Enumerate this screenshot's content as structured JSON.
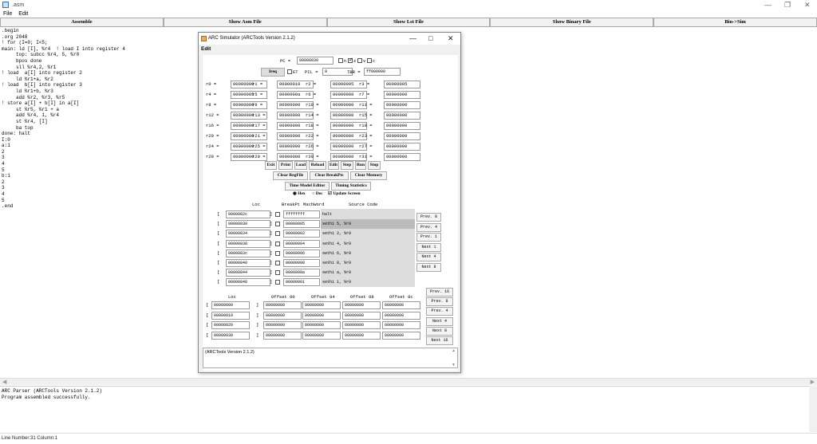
{
  "window": {
    "title": ".asm"
  },
  "menu": [
    "File",
    "Edit"
  ],
  "top_buttons": [
    "Assemble",
    "Show Asm File",
    "Show Lst File",
    "Show Binary File",
    "Bin->Sim"
  ],
  "editor_lines": [
    ".begin",
    ".org 2048",
    "! for (I=0; I<5;",
    "main: ld [I], %r4  ! load I into register 4",
    "     top: subcc %r4, 5, %r0",
    "     bpos done",
    "     sll %r4,2, %r1",
    "! load  a[I] into register 2",
    "     ld %r1+a, %r2",
    "! load  b[I] into register 3",
    "     ld %r1+b, %r3",
    "     add %r2, %r3, %r5",
    "! store a[I] + b[I] in a[I]",
    "     st %r5, %r1 + a",
    "     add %r4, 1, %r4",
    "     st %r4, [I]",
    "     ba top",
    "done: halt",
    "I:0",
    "a:1",
    "2",
    "3",
    "4",
    "5",
    "b:1",
    "2",
    "3",
    "4",
    "5",
    ".end"
  ],
  "console_lines": [
    "ARC Parser (ARCTools Version 2.1.2)",
    "Program assembled successfully."
  ],
  "status": "Line Number:31 Column:1",
  "sim": {
    "title": "ARC Simulator (ARCTools Version 2.1.2)",
    "menu": "Edit",
    "pc_label": "PC =",
    "pc": "00000830",
    "flags": [
      "n",
      "z",
      "v",
      "c"
    ],
    "ireq_label": "Ireq",
    "et_label": "ET",
    "pil_label": "PIL =",
    "pil": "0",
    "tbr_label": "TBR =",
    "tbr": "ff000000",
    "registers": [
      [
        "r0 =",
        "00000000",
        "r1 =",
        "00000010",
        "r2 =",
        "00000005",
        "r3 =",
        "00000005"
      ],
      [
        "r4 =",
        "00000005",
        "r5 =",
        "0000000a",
        "r6 =",
        "00000000",
        "r7 =",
        "00000000"
      ],
      [
        "r8 =",
        "00000000",
        "r9 =",
        "00000000",
        "r10 =",
        "00000000",
        "r11 =",
        "00000000"
      ],
      [
        "r12 =",
        "00000000",
        "r13 =",
        "00000000",
        "r14 =",
        "00000000",
        "r15 =",
        "00000000"
      ],
      [
        "r16 =",
        "00000000",
        "r17 =",
        "00000000",
        "r18 =",
        "00000000",
        "r19 =",
        "00000000"
      ],
      [
        "r20 =",
        "00000000",
        "r21 =",
        "00000000",
        "r22 =",
        "00000000",
        "r23 =",
        "00000000"
      ],
      [
        "r24 =",
        "00000000",
        "r25 =",
        "00000000",
        "r26 =",
        "00000000",
        "r27 =",
        "00000000"
      ],
      [
        "r28 =",
        "00000000",
        "r29 =",
        "00000000",
        "r30 =",
        "00000000",
        "r31 =",
        "00000000"
      ]
    ],
    "buttons_row1": [
      "Exit",
      "Print",
      "Load",
      "Reload",
      "Edit",
      "Step",
      "Run",
      "Stop"
    ],
    "buttons_row2": [
      "Clear RegFile",
      "Clear BreakPts",
      "Clear Memory"
    ],
    "buttons_row3": [
      "Time Model Editor",
      "Timing Statistics"
    ],
    "radio_hex": "Hex",
    "radio_dec": "Dec",
    "update_screen": "Update Screen",
    "code_headers": [
      "Loc",
      "BreakPt",
      "MachWord",
      "Source Code"
    ],
    "code_rows": [
      [
        "0000082c",
        "ffffffff",
        "halt"
      ],
      [
        "00000830",
        "00000005",
        "sethi 5, %r0"
      ],
      [
        "00000834",
        "00000002",
        "sethi 2, %r0"
      ],
      [
        "00000838",
        "00000004",
        "sethi 4, %r0"
      ],
      [
        "0000083c",
        "00000006",
        "sethi 6, %r0"
      ],
      [
        "00000840",
        "00000008",
        "sethi 8, %r0"
      ],
      [
        "00000844",
        "0000000a",
        "sethi a, %r0"
      ],
      [
        "00000848",
        "00000001",
        "sethi 1, %r0"
      ]
    ],
    "code_nav": [
      "Prev. 8",
      "Prev. 4",
      "Prev. 1",
      "Next  1",
      "Next  4",
      "Next  8"
    ],
    "mem_headers": [
      "Loc",
      "Offset 00",
      "Offset 04",
      "Offset 08",
      "Offset 0c"
    ],
    "mem_rows": [
      [
        "00000000",
        "00000000",
        "00000000",
        "00000000",
        "00000000"
      ],
      [
        "00000010",
        "00000000",
        "00000000",
        "00000000",
        "00000000"
      ],
      [
        "00000020",
        "00000000",
        "00000000",
        "00000000",
        "00000000"
      ],
      [
        "00000030",
        "00000000",
        "00000000",
        "00000000",
        "00000000"
      ]
    ],
    "mem_nav": [
      "Prev. 16",
      "Prev.  8",
      "Prev.  4",
      "Next   4",
      "Next   8",
      "Next  16"
    ],
    "log": "(ARCTools Version 2.1.2)"
  }
}
